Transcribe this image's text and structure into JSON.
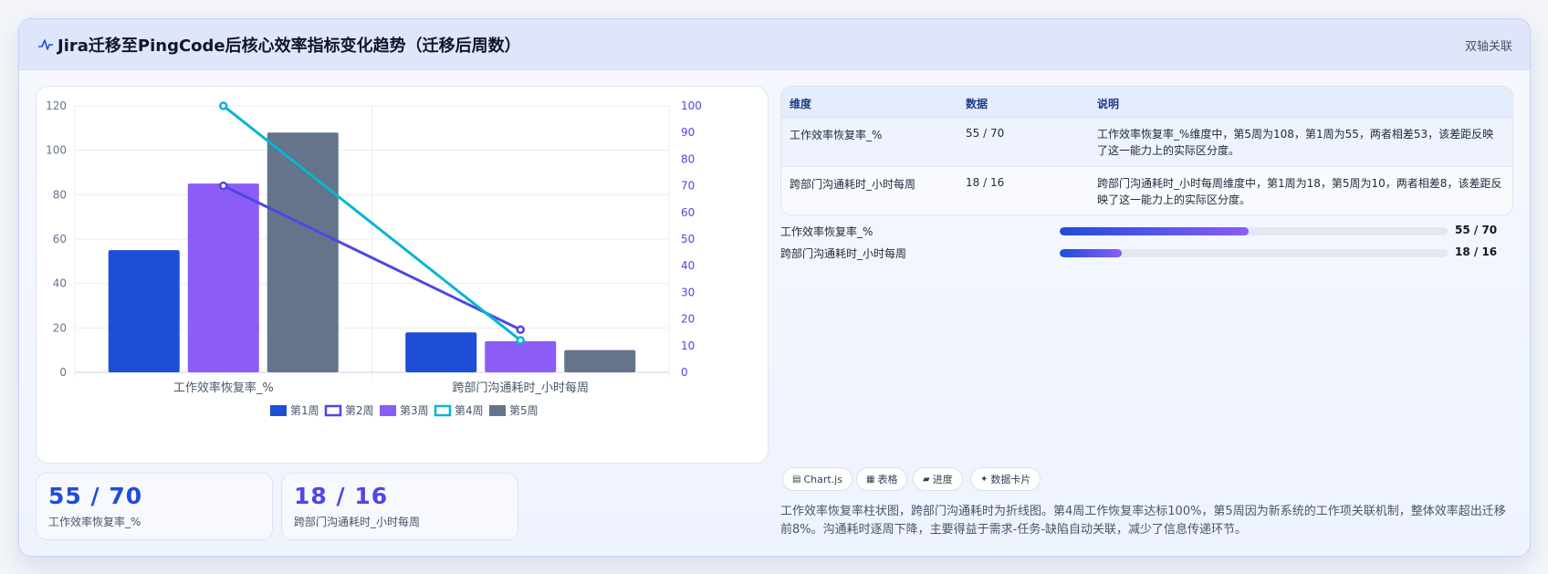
{
  "header": {
    "title": "Jira迁移至PingCode后核心效率指标变化趋势（迁移后周数）",
    "tag": "双轴关联"
  },
  "icons": {
    "title_icon": "pulse-icon"
  },
  "colors": {
    "week1": "#1d4ed8",
    "week2": "#4f46e5",
    "week3": "#8b5cf6",
    "week4": "#06b6d4",
    "week5": "#64748b"
  },
  "chart_data": {
    "type": "bar",
    "categories": [
      "工作效率恢复率_%",
      "跨部门沟通耗时_小时每周"
    ],
    "series": [
      {
        "name": "第1周",
        "type": "bar",
        "axis": "left",
        "values": [
          55,
          18
        ]
      },
      {
        "name": "第2周",
        "type": "line",
        "axis": "right",
        "values": [
          70,
          16
        ]
      },
      {
        "name": "第3周",
        "type": "bar",
        "axis": "left",
        "values": [
          85,
          14
        ]
      },
      {
        "name": "第4周",
        "type": "line",
        "axis": "right",
        "values": [
          100,
          12
        ]
      },
      {
        "name": "第5周",
        "type": "bar",
        "axis": "left",
        "values": [
          108,
          10
        ]
      }
    ],
    "y_left": {
      "min": 0,
      "max": 120,
      "ticks": [
        "0",
        "20",
        "40",
        "60",
        "80",
        "100",
        "120"
      ]
    },
    "y_right": {
      "min": 0,
      "max": 100,
      "ticks": [
        "0",
        "10",
        "20",
        "30",
        "40",
        "50",
        "60",
        "70",
        "80",
        "90",
        "100"
      ]
    },
    "legend": [
      "第1周",
      "第2周",
      "第3周",
      "第4周",
      "第5周"
    ],
    "legend_position": "bottom",
    "grid": true
  },
  "kpis": [
    {
      "value": "55 / 70",
      "label": "工作效率恢复率_%"
    },
    {
      "value": "18 / 16",
      "label": "跨部门沟通耗时_小时每周"
    }
  ],
  "table": {
    "headers": [
      "维度",
      "数据",
      "说明"
    ],
    "rows": [
      {
        "dimension": "工作效率恢复率_%",
        "data": "55 / 70",
        "note": "工作效率恢复率_%维度中，第5周为108，第1周为55，两者相差53，该差距反映了这一能力上的实际区分度。"
      },
      {
        "dimension": "跨部门沟通耗时_小时每周",
        "data": "18 / 16",
        "note": "跨部门沟通耗时_小时每周维度中，第1周为18，第5周为10，两者相差8，该差距反映了这一能力上的实际区分度。"
      }
    ]
  },
  "progress": [
    {
      "label": "工作效率恢复率_%",
      "value": "55 / 70",
      "fraction": 0.486
    },
    {
      "label": "跨部门沟通耗时_小时每周",
      "value": "18 / 16",
      "fraction": 0.159
    }
  ],
  "chips": [
    {
      "icon": "▤",
      "icon_name": "chart-icon",
      "label": "Chart.js"
    },
    {
      "icon": "▦",
      "icon_name": "table-icon",
      "label": "表格"
    },
    {
      "icon": "▰",
      "icon_name": "progress-icon",
      "label": "进度"
    },
    {
      "icon": "✦",
      "icon_name": "sparkle-icon",
      "label": "数据卡片"
    }
  ],
  "description": "工作效率恢复率柱状图，跨部门沟通耗时为折线图。第4周工作恢复率达标100%，第5周因为新系统的工作项关联机制，整体效率超出迁移前8%。沟通耗时逐周下降，主要得益于需求-任务-缺陷自动关联，减少了信息传递环节。"
}
